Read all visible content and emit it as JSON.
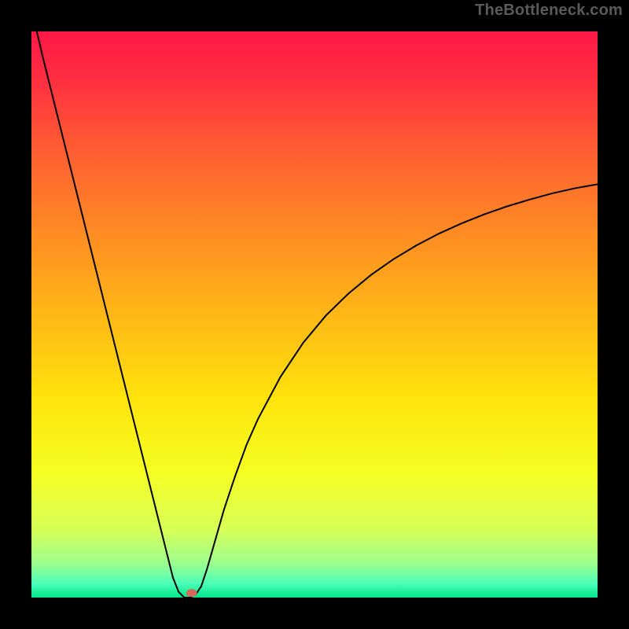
{
  "watermark": "TheBottleneck.com",
  "chart_data": {
    "type": "line",
    "title": "",
    "xlabel": "",
    "ylabel": "",
    "xlim": [
      0,
      100
    ],
    "ylim": [
      0,
      100
    ],
    "grid": false,
    "legend": false,
    "background": {
      "kind": "vertical-gradient",
      "stops": [
        {
          "pos": 0.0,
          "color": "#ff1846"
        },
        {
          "pos": 0.08,
          "color": "#ff2d41"
        },
        {
          "pos": 0.2,
          "color": "#ff5a33"
        },
        {
          "pos": 0.35,
          "color": "#ff8a24"
        },
        {
          "pos": 0.5,
          "color": "#ffb716"
        },
        {
          "pos": 0.65,
          "color": "#ffe40c"
        },
        {
          "pos": 0.78,
          "color": "#f5ff23"
        },
        {
          "pos": 0.88,
          "color": "#d7ff57"
        },
        {
          "pos": 0.94,
          "color": "#9cff8f"
        },
        {
          "pos": 0.975,
          "color": "#4dffb8"
        },
        {
          "pos": 1.0,
          "color": "#00e68a"
        }
      ]
    },
    "series": [
      {
        "name": "bottleneck-curve",
        "color": "#000000",
        "x": [
          0.0,
          2.0,
          4.0,
          6.0,
          8.0,
          10.0,
          12.0,
          14.0,
          16.0,
          18.0,
          20.0,
          22.0,
          24.0,
          25.0,
          26.0,
          27.0,
          28.0,
          29.0,
          30.0,
          31.0,
          32.0,
          34.0,
          36.0,
          38.0,
          40.0,
          44.0,
          48.0,
          52.0,
          56.0,
          60.0,
          64.0,
          68.0,
          72.0,
          76.0,
          80.0,
          84.0,
          88.0,
          92.0,
          96.0,
          100.0
        ],
        "y": [
          104.0,
          95.5,
          87.5,
          79.5,
          71.5,
          63.5,
          55.5,
          47.5,
          39.5,
          31.5,
          23.5,
          15.5,
          7.5,
          3.5,
          1.0,
          0.0,
          0.0,
          0.5,
          2.0,
          5.0,
          8.5,
          15.5,
          21.5,
          27.0,
          31.5,
          39.0,
          45.0,
          49.8,
          53.7,
          57.0,
          59.8,
          62.2,
          64.3,
          66.1,
          67.7,
          69.1,
          70.3,
          71.4,
          72.3,
          73.0
        ]
      }
    ],
    "marker": {
      "name": "optimal-point",
      "x": 28.3,
      "y": 0.8,
      "color": "#d46a5a",
      "rx": 7,
      "ry": 5
    }
  }
}
